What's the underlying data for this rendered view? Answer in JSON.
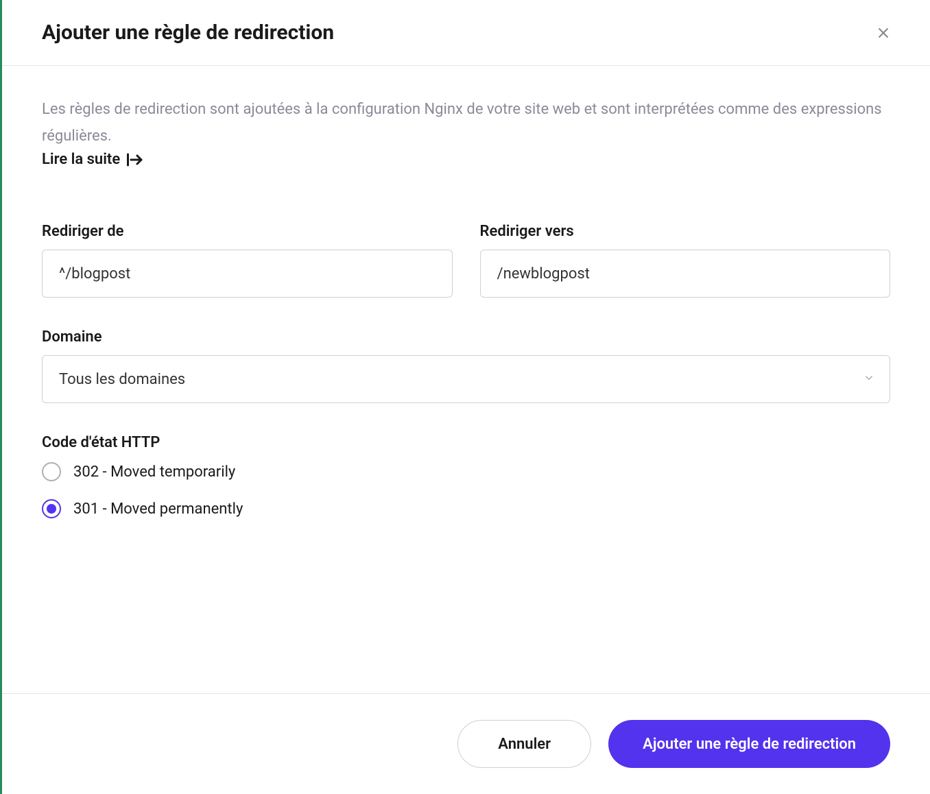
{
  "header": {
    "title": "Ajouter une règle de redirection"
  },
  "intro": {
    "description": "Les règles de redirection sont ajoutées à la configuration Nginx de votre site web et sont interprétées comme des expressions régulières.",
    "read_more": "Lire la suite"
  },
  "form": {
    "redirect_from": {
      "label": "Rediriger de",
      "value": "^/blogpost"
    },
    "redirect_to": {
      "label": "Rediriger vers",
      "value": "/newblogpost"
    },
    "domain": {
      "label": "Domaine",
      "selected": "Tous les domaines"
    },
    "http_status": {
      "label": "Code d'état HTTP",
      "options": [
        {
          "label": "302 - Moved temporarily",
          "checked": false
        },
        {
          "label": "301 - Moved permanently",
          "checked": true
        }
      ]
    }
  },
  "footer": {
    "cancel": "Annuler",
    "submit": "Ajouter une règle de redirection"
  }
}
